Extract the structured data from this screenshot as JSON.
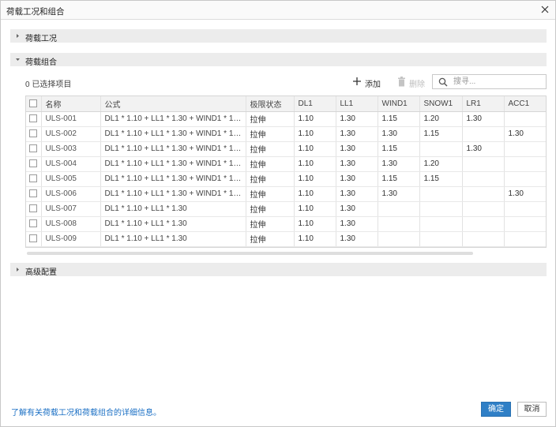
{
  "dialog": {
    "title": "荷载工况和组合",
    "close_icon": "close-icon"
  },
  "sections": {
    "load_cases": {
      "label": "荷载工况",
      "expanded": false
    },
    "load_combinations": {
      "label": "荷载组合",
      "expanded": true
    },
    "advanced": {
      "label": "高级配置",
      "expanded": false
    }
  },
  "toolbar": {
    "selected_count": "0 已选择项目",
    "add_label": "添加",
    "delete_label": "删除",
    "search_placeholder": "搜寻..."
  },
  "table": {
    "headers": [
      "名称",
      "公式",
      "极限状态",
      "DL1",
      "LL1",
      "WIND1",
      "SNOW1",
      "LR1",
      "ACC1"
    ],
    "rows": [
      {
        "name": "ULS-001",
        "formula": "DL1 * 1.10 + LL1 * 1.30 + WIND1 * 1.15 + ...",
        "state": "拉伸",
        "DL1": "1.10",
        "LL1": "1.30",
        "WIND1": "1.15",
        "SNOW1": "1.20",
        "LR1": "1.30",
        "ACC1": ""
      },
      {
        "name": "ULS-002",
        "formula": "DL1 * 1.10 + LL1 * 1.30 + WIND1 * 1.30 + ...",
        "state": "拉伸",
        "DL1": "1.10",
        "LL1": "1.30",
        "WIND1": "1.30",
        "SNOW1": "1.15",
        "LR1": "",
        "ACC1": "1.30"
      },
      {
        "name": "ULS-003",
        "formula": "DL1 * 1.10 + LL1 * 1.30 + WIND1 * 1.15 + ...",
        "state": "拉伸",
        "DL1": "1.10",
        "LL1": "1.30",
        "WIND1": "1.15",
        "SNOW1": "",
        "LR1": "1.30",
        "ACC1": ""
      },
      {
        "name": "ULS-004",
        "formula": "DL1 * 1.10 + LL1 * 1.30 + WIND1 * 1.30 + ...",
        "state": "拉伸",
        "DL1": "1.10",
        "LL1": "1.30",
        "WIND1": "1.30",
        "SNOW1": "1.20",
        "LR1": "",
        "ACC1": ""
      },
      {
        "name": "ULS-005",
        "formula": "DL1 * 1.10 + LL1 * 1.30 + WIND1 * 1.15 + ...",
        "state": "拉伸",
        "DL1": "1.10",
        "LL1": "1.30",
        "WIND1": "1.15",
        "SNOW1": "1.15",
        "LR1": "",
        "ACC1": ""
      },
      {
        "name": "ULS-006",
        "formula": "DL1 * 1.10 + LL1 * 1.30 + WIND1 * 1.30 + ...",
        "state": "拉伸",
        "DL1": "1.10",
        "LL1": "1.30",
        "WIND1": "1.30",
        "SNOW1": "",
        "LR1": "",
        "ACC1": "1.30"
      },
      {
        "name": "ULS-007",
        "formula": "DL1 * 1.10 + LL1 * 1.30",
        "state": "拉伸",
        "DL1": "1.10",
        "LL1": "1.30",
        "WIND1": "",
        "SNOW1": "",
        "LR1": "",
        "ACC1": ""
      },
      {
        "name": "ULS-008",
        "formula": "DL1 * 1.10 + LL1 * 1.30",
        "state": "拉伸",
        "DL1": "1.10",
        "LL1": "1.30",
        "WIND1": "",
        "SNOW1": "",
        "LR1": "",
        "ACC1": ""
      },
      {
        "name": "ULS-009",
        "formula": "DL1 * 1.10 + LL1 * 1.30",
        "state": "拉伸",
        "DL1": "1.10",
        "LL1": "1.30",
        "WIND1": "",
        "SNOW1": "",
        "LR1": "",
        "ACC1": ""
      }
    ]
  },
  "footer": {
    "help_link": "了解有关荷载工况和荷载组合的详细信息。",
    "ok_label": "确定",
    "cancel_label": "取消"
  },
  "colors": {
    "accent": "#2f7fc6",
    "link": "#1a6fc4",
    "section_bg": "#ececec"
  }
}
